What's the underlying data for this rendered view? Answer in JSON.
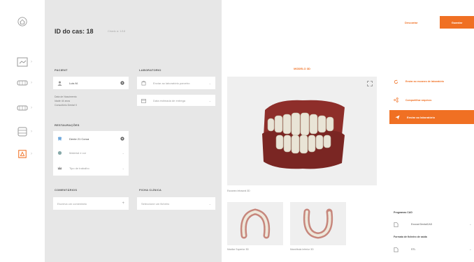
{
  "header": {
    "title": "ID do cas: 18",
    "subtitle": "Criado a: 1/18"
  },
  "patient": {
    "section": "PACIENT",
    "name": "Luis M.",
    "details_line1": "Data de Nascimento",
    "details_line2": "Idade          44 anos",
    "details_line3": "Consultório    Dental X"
  },
  "laboratory": {
    "section": "LABORATORIO",
    "field1_placeholder": "Enviar ao laboratório parceiro",
    "field2_placeholder": "Data estimada de entrega"
  },
  "restorations": {
    "section": "RESTAURAÇÕES",
    "item1": "Dente 21 Coroa",
    "item2": "Material e cor",
    "item3": "Tipo de trabalho"
  },
  "notes": {
    "section": "COMENTÁRIOS",
    "placeholder": "Escreva um comentário"
  },
  "quality": {
    "section": "FICHA CLÍNICA",
    "placeholder": "Seleccione um ficheiro"
  },
  "center": {
    "label": "MODELO 3D",
    "main_caption": "Escaneo intraoral 3D",
    "thumb1_caption": "Maxilar Superior 3D",
    "thumb2_caption": "Mandíbula Inferior 3D"
  },
  "right": {
    "discard_label": "Descartar",
    "save_label": "Guardar",
    "action1": "Enviar ao escaneo de laboratório",
    "action2": "Compartilhar arquivos",
    "send_label": "Enviar ao laboratório",
    "prog_section": "Programas CAD",
    "prog_value": "Exocad DentalCAD",
    "format_section": "Formato de ficheiro de saída",
    "format_value": "STL"
  },
  "colors": {
    "accent": "#f07023",
    "panel": "#e7e7e7",
    "gum": "#8e2e2a"
  }
}
